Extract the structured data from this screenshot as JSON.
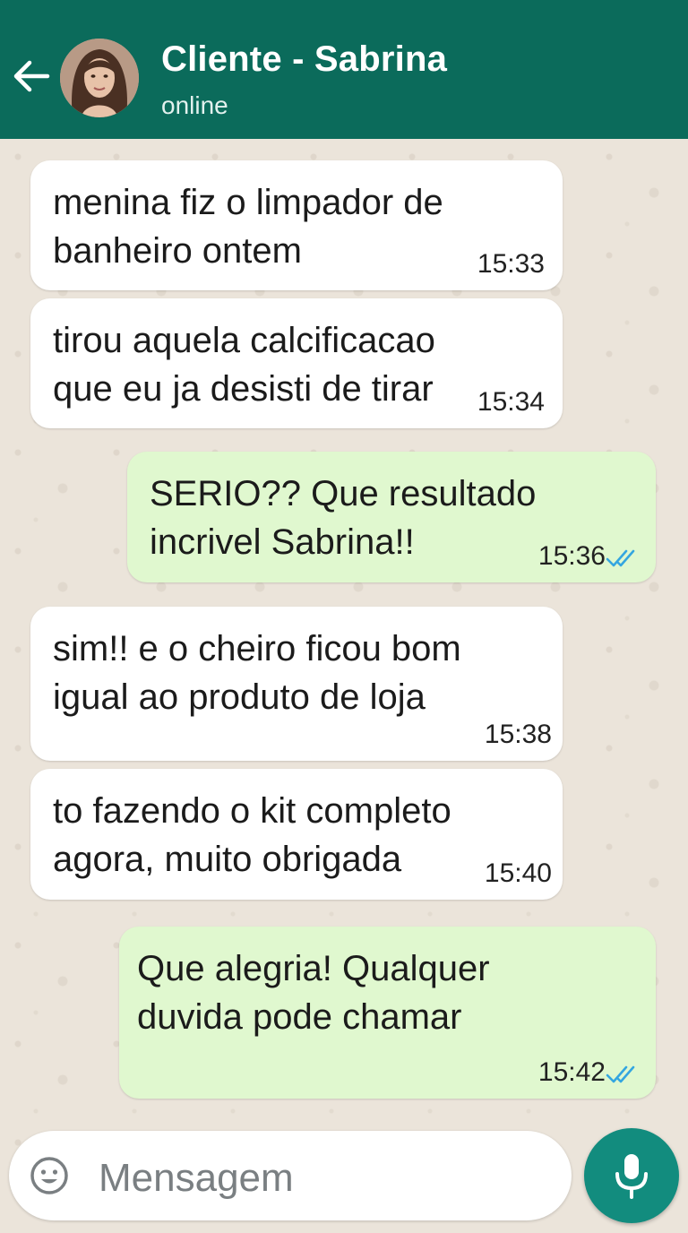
{
  "header": {
    "contact_name": "Cliente - Sabrina",
    "status": "online",
    "back_icon": "arrow-left-icon",
    "color": "#0b6b5b"
  },
  "messages": [
    {
      "direction": "incoming",
      "lines": [
        "menina fiz o limpador de",
        "banheiro ontem"
      ],
      "time": "15:33"
    },
    {
      "direction": "incoming",
      "lines": [
        "tirou aquela calcificacao",
        "que eu ja desisti de tirar"
      ],
      "time": "15:34"
    },
    {
      "direction": "outgoing",
      "lines": [
        "SERIO?? Que resultado",
        "incrivel Sabrina!!"
      ],
      "time": "15:36",
      "status_icon": "double-check-icon"
    },
    {
      "direction": "incoming",
      "lines": [
        "sim!! e o cheiro ficou bom",
        "igual ao produto de loja"
      ],
      "time": "15:38"
    },
    {
      "direction": "incoming",
      "lines": [
        "to fazendo o kit completo",
        "agora, muito obrigada"
      ],
      "time": "15:40"
    },
    {
      "direction": "outgoing",
      "lines": [
        "Que alegria! Qualquer",
        "duvida pode chamar"
      ],
      "time": "15:42",
      "status_icon": "double-check-icon"
    }
  ],
  "composer": {
    "placeholder": "Mensagem",
    "emoji_icon": "emoji-icon",
    "mic_icon": "microphone-icon",
    "mic_color": "#128c7e"
  },
  "colors": {
    "incoming_bubble": "#ffffff",
    "outgoing_bubble": "#e0f8cf",
    "read_ticks": "#34a6e0"
  }
}
